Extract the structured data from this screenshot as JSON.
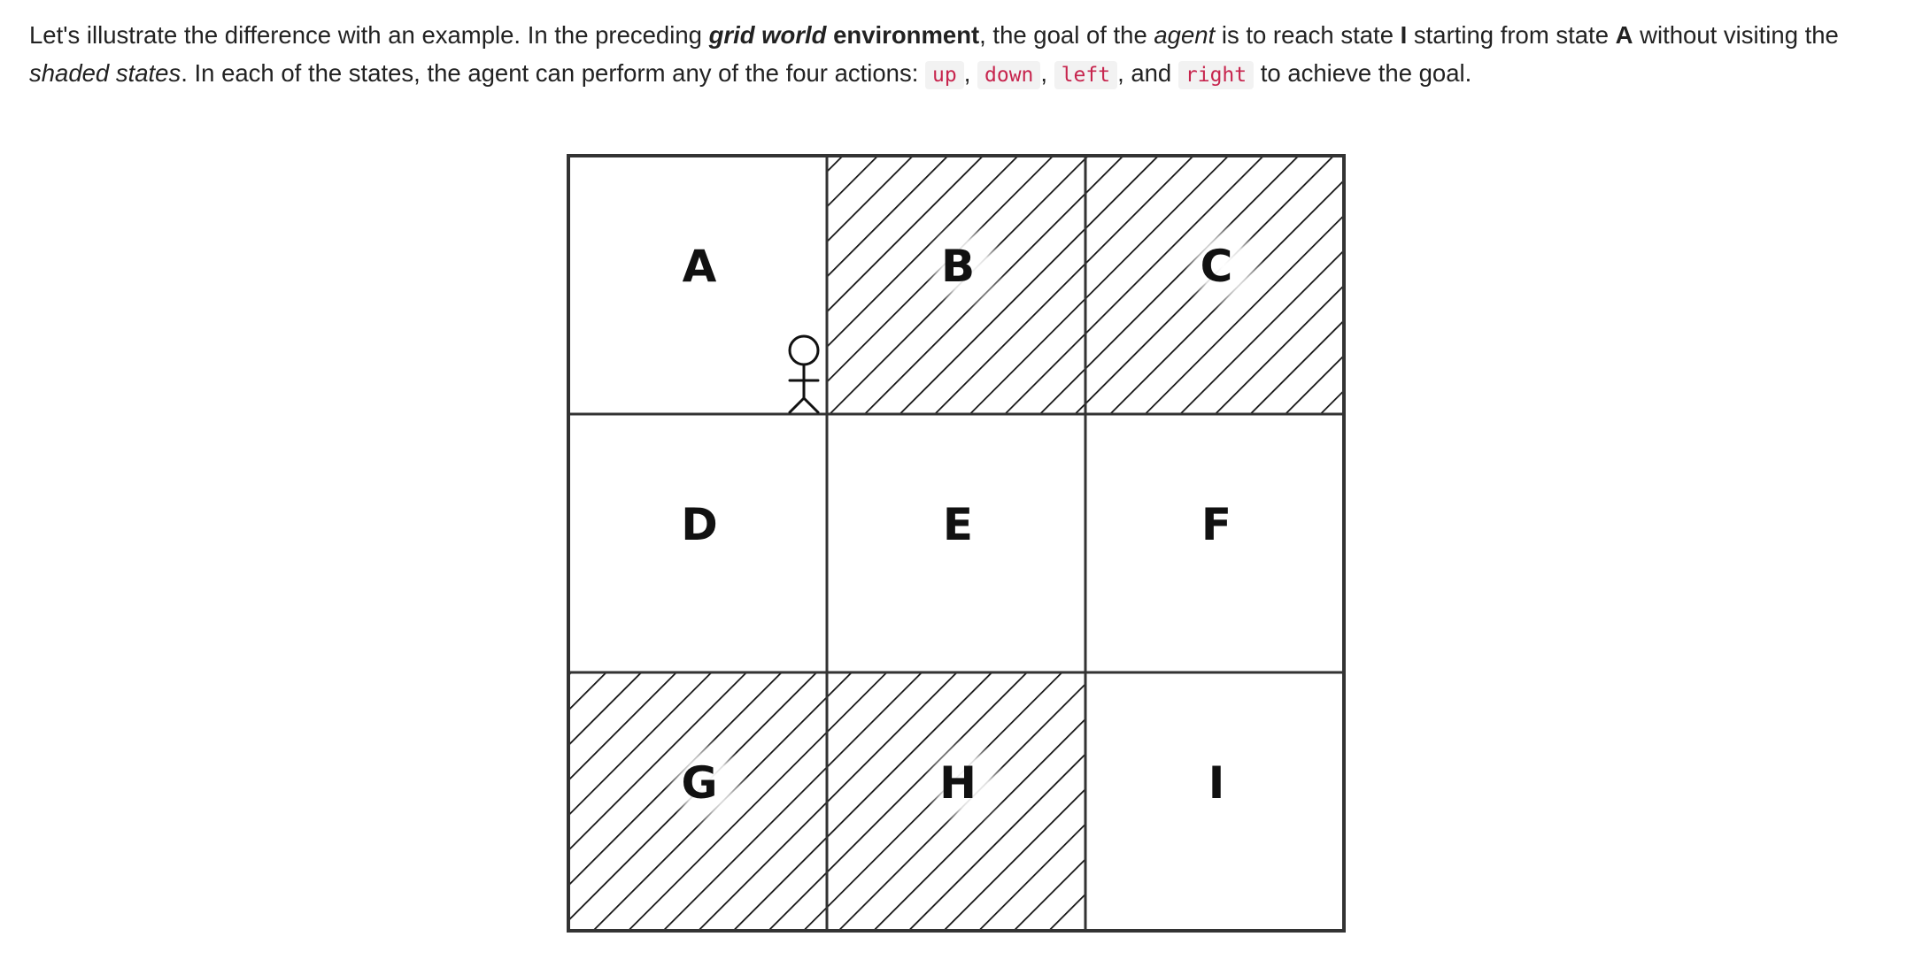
{
  "paragraph": {
    "t1": "Let's illustrate the difference with an example. In the preceding ",
    "grid_world": "grid world",
    "t2": " ",
    "environment": "environment",
    "t3": ", the goal of the ",
    "agent": "agent",
    "t4": " is to reach state ",
    "goal_state": "I",
    "t5": " starting from state ",
    "start_state": "A",
    "t6": " without visiting the ",
    "shaded_states": "shaded states",
    "t7": ". In each of the states, the agent can perform any of the four actions: ",
    "actions": [
      "up",
      "down",
      "left",
      "right"
    ],
    "sep1": ", ",
    "sep2": ", ",
    "sep3": ", and ",
    "t8": " to achieve the goal."
  },
  "grid": {
    "rows": 3,
    "cols": 3,
    "cells": [
      {
        "label": "A",
        "shaded": false
      },
      {
        "label": "B",
        "shaded": true
      },
      {
        "label": "C",
        "shaded": true
      },
      {
        "label": "D",
        "shaded": false
      },
      {
        "label": "E",
        "shaded": false
      },
      {
        "label": "F",
        "shaded": false
      },
      {
        "label": "G",
        "shaded": true
      },
      {
        "label": "H",
        "shaded": true
      },
      {
        "label": "I",
        "shaded": false
      }
    ],
    "agent_icon": "stick-figure-icon",
    "agent_cell": "A"
  }
}
